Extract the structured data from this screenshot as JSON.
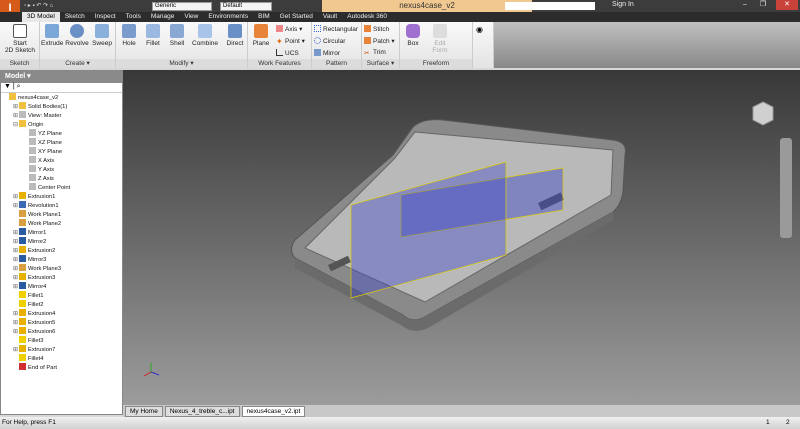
{
  "title_bar": {
    "document": "nexus4case_v2",
    "appearance": "Generic",
    "design_view": "Default",
    "search_placeholder": "",
    "sign_in": "Sign In",
    "logo": "I"
  },
  "tabs": [
    "3D Model",
    "Sketch",
    "Inspect",
    "Tools",
    "Manage",
    "View",
    "Environments",
    "BIM",
    "Get Started",
    "Vault",
    "Autodesk 360"
  ],
  "ribbon": {
    "sketch": {
      "label": "Sketch",
      "start": "Start",
      "start2": "2D Sketch"
    },
    "create": {
      "label": "Create ▾",
      "items": [
        "Extrude",
        "Revolve",
        "Sweep"
      ]
    },
    "modify": {
      "label": "Modify ▾",
      "items": [
        "Hole",
        "Fillet",
        "Shell",
        "Combine",
        "Direct"
      ]
    },
    "work_features": {
      "label": "Work Features",
      "plane": "Plane",
      "axis": "Axis ▾",
      "point": "Point ▾",
      "ucs": "UCS"
    },
    "pattern": {
      "label": "Pattern",
      "items": [
        "Rectangular",
        "Circular",
        "Mirror"
      ]
    },
    "surface": {
      "label": "Surface ▾",
      "items": [
        "Stitch",
        "Patch ▾",
        "Trim"
      ]
    },
    "freeform": {
      "label": "Freeform",
      "box": "Box",
      "edit": "Edit",
      "form": "Form"
    }
  },
  "browser": {
    "title": "Model ▾",
    "items": [
      {
        "label": "nexus4case_v2",
        "level": 0,
        "exp": ""
      },
      {
        "label": "Solid Bodies(1)",
        "level": 1,
        "exp": "+"
      },
      {
        "label": "View: Master",
        "level": 1,
        "exp": "+"
      },
      {
        "label": "Origin",
        "level": 1,
        "exp": "-"
      },
      {
        "label": "YZ Plane",
        "level": 2,
        "exp": ""
      },
      {
        "label": "XZ Plane",
        "level": 2,
        "exp": ""
      },
      {
        "label": "XY Plane",
        "level": 2,
        "exp": ""
      },
      {
        "label": "X Axis",
        "level": 2,
        "exp": ""
      },
      {
        "label": "Y Axis",
        "level": 2,
        "exp": ""
      },
      {
        "label": "Z Axis",
        "level": 2,
        "exp": ""
      },
      {
        "label": "Center Point",
        "level": 2,
        "exp": ""
      },
      {
        "label": "Extrusion1",
        "level": 1,
        "exp": "+"
      },
      {
        "label": "Revolution1",
        "level": 1,
        "exp": "+"
      },
      {
        "label": "Work Plane1",
        "level": 1,
        "exp": ""
      },
      {
        "label": "Work Plane2",
        "level": 1,
        "exp": ""
      },
      {
        "label": "Mirror1",
        "level": 1,
        "exp": "+"
      },
      {
        "label": "Mirror2",
        "level": 1,
        "exp": "+"
      },
      {
        "label": "Extrusion2",
        "level": 1,
        "exp": "+"
      },
      {
        "label": "Mirror3",
        "level": 1,
        "exp": "+"
      },
      {
        "label": "Work Plane3",
        "level": 1,
        "exp": "+"
      },
      {
        "label": "Extrusion3",
        "level": 1,
        "exp": "+"
      },
      {
        "label": "Mirror4",
        "level": 1,
        "exp": "+"
      },
      {
        "label": "Fillet1",
        "level": 1,
        "exp": ""
      },
      {
        "label": "Fillet2",
        "level": 1,
        "exp": ""
      },
      {
        "label": "Extrusion4",
        "level": 1,
        "exp": "+"
      },
      {
        "label": "Extrusion5",
        "level": 1,
        "exp": "+"
      },
      {
        "label": "Extrusion6",
        "level": 1,
        "exp": "+"
      },
      {
        "label": "Fillet3",
        "level": 1,
        "exp": ""
      },
      {
        "label": "Extrusion7",
        "level": 1,
        "exp": "+"
      },
      {
        "label": "Fillet4",
        "level": 1,
        "exp": ""
      },
      {
        "label": "End of Part",
        "level": 1,
        "exp": ""
      }
    ]
  },
  "doc_tabs": [
    "My Home",
    "Nexus_4_treble_c...ipt",
    "nexus4case_v2.ipt"
  ],
  "status": {
    "help": "For Help, press F1",
    "n1": "1",
    "n2": "2"
  }
}
